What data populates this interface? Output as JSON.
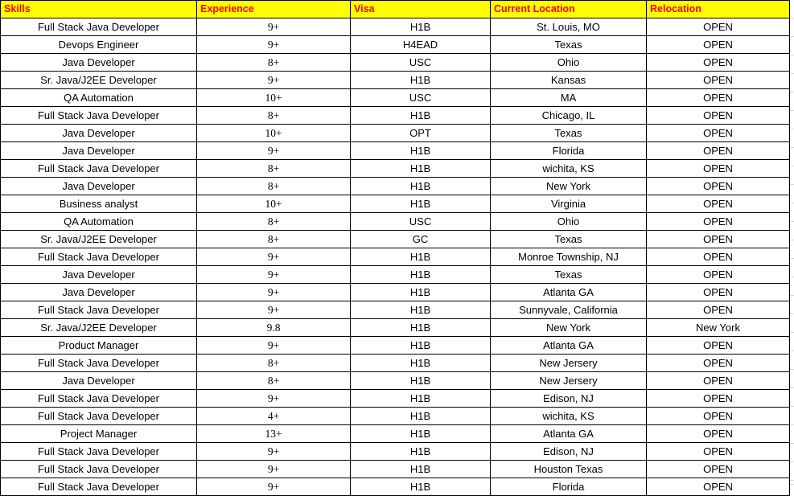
{
  "table": {
    "columns": [
      {
        "key": "skills",
        "label": "Skills",
        "name": "column-header-skills"
      },
      {
        "key": "experience",
        "label": "Experience",
        "name": "column-header-experience"
      },
      {
        "key": "visa",
        "label": "Visa",
        "name": "column-header-visa"
      },
      {
        "key": "location",
        "label": "Current Location",
        "name": "column-header-current-location"
      },
      {
        "key": "relocation",
        "label": "Relocation",
        "name": "column-header-relocation"
      }
    ],
    "header_background": "#ffff00",
    "header_text_color": "#ff0000",
    "border_color": "#000000",
    "row_count": 27,
    "rows": [
      {
        "skills": "Full Stack Java Developer",
        "experience": "9+",
        "visa": "H1B",
        "location": "St. Louis, MO",
        "relocation": "OPEN"
      },
      {
        "skills": "Devops Engineer",
        "experience": "9+",
        "visa": "H4EAD",
        "location": "Texas",
        "relocation": "OPEN"
      },
      {
        "skills": "Java Developer",
        "experience": "8+",
        "visa": "USC",
        "location": "Ohio",
        "relocation": "OPEN"
      },
      {
        "skills": "Sr. Java/J2EE Developer",
        "experience": "9+",
        "visa": "H1B",
        "location": "Kansas",
        "relocation": "OPEN"
      },
      {
        "skills": "QA Automation",
        "experience": "10+",
        "visa": "USC",
        "location": "MA",
        "relocation": "OPEN"
      },
      {
        "skills": "Full Stack Java Developer",
        "experience": "8+",
        "visa": "H1B",
        "location": "Chicago, IL",
        "relocation": "OPEN"
      },
      {
        "skills": "Java Developer",
        "experience": "10+",
        "visa": "OPT",
        "location": "Texas",
        "relocation": "OPEN"
      },
      {
        "skills": "Java Developer",
        "experience": "9+",
        "visa": "H1B",
        "location": "Florida",
        "relocation": "OPEN"
      },
      {
        "skills": "Full Stack Java Developer",
        "experience": "8+",
        "visa": "H1B",
        "location": "wichita, KS",
        "relocation": "OPEN"
      },
      {
        "skills": "Java Developer",
        "experience": "8+",
        "visa": "H1B",
        "location": "New York",
        "relocation": "OPEN"
      },
      {
        "skills": "Business analyst",
        "experience": "10+",
        "visa": "H1B",
        "location": "Virginia",
        "relocation": "OPEN"
      },
      {
        "skills": "QA Automation",
        "experience": "8+",
        "visa": "USC",
        "location": "Ohio",
        "relocation": "OPEN"
      },
      {
        "skills": "Sr. Java/J2EE Developer",
        "experience": "8+",
        "visa": "GC",
        "location": "Texas",
        "relocation": "OPEN"
      },
      {
        "skills": "Full Stack Java Developer",
        "experience": "9+",
        "visa": "H1B",
        "location": "Monroe Township, NJ",
        "relocation": "OPEN"
      },
      {
        "skills": "Java Developer",
        "experience": "9+",
        "visa": "H1B",
        "location": "Texas",
        "relocation": "OPEN"
      },
      {
        "skills": "Java Developer",
        "experience": "9+",
        "visa": "H1B",
        "location": "Atlanta GA",
        "relocation": "OPEN"
      },
      {
        "skills": "Full Stack Java Developer",
        "experience": "9+",
        "visa": "H1B",
        "location": "Sunnyvale, California",
        "relocation": "OPEN"
      },
      {
        "skills": "Sr. Java/J2EE Developer",
        "experience": "9.8",
        "visa": "H1B",
        "location": "New York",
        "relocation": "New York"
      },
      {
        "skills": "Product Manager",
        "experience": "9+",
        "visa": "H1B",
        "location": "Atlanta GA",
        "relocation": "OPEN"
      },
      {
        "skills": "Full Stack Java Developer",
        "experience": "8+",
        "visa": "H1B",
        "location": "New Jersery",
        "relocation": "OPEN"
      },
      {
        "skills": "Java Developer",
        "experience": "8+",
        "visa": "H1B",
        "location": "New Jersery",
        "relocation": "OPEN"
      },
      {
        "skills": "Full Stack Java Developer",
        "experience": "9+",
        "visa": "H1B",
        "location": "Edison, NJ",
        "relocation": "OPEN"
      },
      {
        "skills": "Full Stack Java Developer",
        "experience": "4+",
        "visa": "H1B",
        "location": "wichita, KS",
        "relocation": "OPEN"
      },
      {
        "skills": "Project Manager",
        "experience": "13+",
        "visa": "H1B",
        "location": "Atlanta GA",
        "relocation": "OPEN"
      },
      {
        "skills": "Full Stack Java Developer",
        "experience": "9+",
        "visa": "H1B",
        "location": "Edison, NJ",
        "relocation": "OPEN"
      },
      {
        "skills": "Full Stack Java Developer",
        "experience": "9+",
        "visa": "H1B",
        "location": "Houston Texas",
        "relocation": "OPEN"
      },
      {
        "skills": "Full Stack Java Developer",
        "experience": "9+",
        "visa": "H1B",
        "location": "Florida",
        "relocation": "OPEN"
      }
    ]
  }
}
